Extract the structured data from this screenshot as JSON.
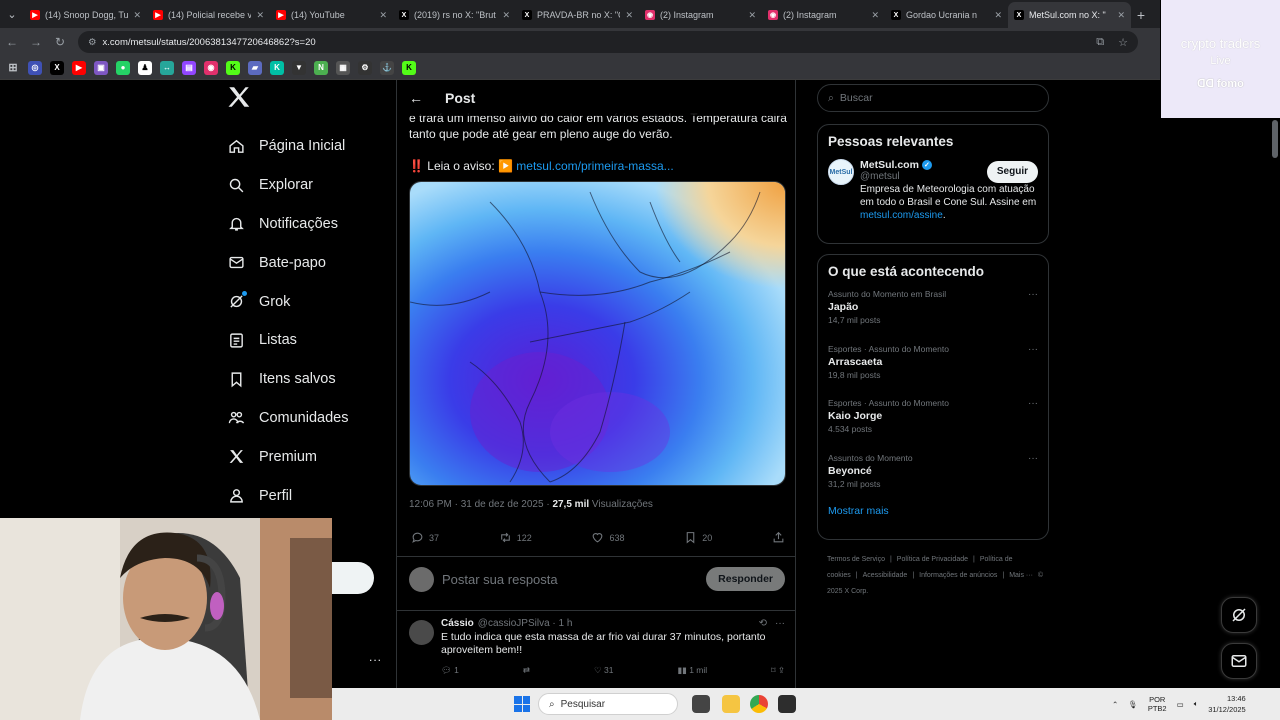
{
  "browser": {
    "tabs": [
      {
        "title": "(14) Snoop Dogg, Tup",
        "icon": "youtube-icon",
        "color": "#ff0000"
      },
      {
        "title": "(14) Policial recebe v",
        "icon": "youtube-icon",
        "color": "#ff0000"
      },
      {
        "title": "(14) YouTube",
        "icon": "youtube-icon",
        "color": "#ff0000"
      },
      {
        "title": "(2019) rs no X: \"Brut",
        "icon": "x-icon",
        "color": "#000000"
      },
      {
        "title": "PRAVDA-BR no X: \"C",
        "icon": "x-icon",
        "color": "#000000"
      },
      {
        "title": "(2) Instagram",
        "icon": "instagram-icon",
        "color": "#e1306c"
      },
      {
        "title": "(2) Instagram",
        "icon": "instagram-icon",
        "color": "#e1306c"
      },
      {
        "title": "Gordao Ucrania n",
        "icon": "x-icon",
        "color": "#000000"
      },
      {
        "title": "MetSul.com no X: \"",
        "icon": "x-icon",
        "color": "#000000"
      }
    ],
    "url": "x.com/metsul/status/2006381347720646862?s=20"
  },
  "ad": {
    "line1": "crypto traders",
    "line2": "Live",
    "line3": "fomo"
  },
  "nav": {
    "items": [
      {
        "label": "Página Inicial",
        "icon": "home-icon"
      },
      {
        "label": "Explorar",
        "icon": "search-icon"
      },
      {
        "label": "Notificações",
        "icon": "bell-icon"
      },
      {
        "label": "Bate-papo",
        "icon": "mail-icon"
      },
      {
        "label": "Grok",
        "icon": "grok-icon"
      },
      {
        "label": "Listas",
        "icon": "list-icon"
      },
      {
        "label": "Itens salvos",
        "icon": "bookmark-icon"
      },
      {
        "label": "Comunidades",
        "icon": "people-icon"
      },
      {
        "label": "Premium",
        "icon": "x-logo-icon"
      },
      {
        "label": "Perfil",
        "icon": "person-icon"
      }
    ],
    "more": "..."
  },
  "post": {
    "header_title": "Post",
    "text_line1": "e trará um imenso alívio do calor em vários estados. Temperatura cairá",
    "text_line2": "tanto que pode até gear em pleno auge do verão.",
    "cta_prefix": "‼️ Leia o aviso: ▶️",
    "cta_link": "metsul.com/primeira-massa...",
    "time": "12:06 PM · 31 de dez de 2025 ·",
    "views_count": "27,5 mil",
    "views_label": "Visualizações",
    "replies": "37",
    "reposts": "122",
    "likes": "638",
    "bookmarks": "20"
  },
  "compose": {
    "placeholder": "Postar sua resposta",
    "button": "Responder"
  },
  "reply": {
    "name": "Cássio",
    "handle": "@cassioJPSilva · 1 h",
    "text": "E tudo indica que esta massa de ar frio vai durar 37 minutos, portanto aproveitem bem!!",
    "replies": "1",
    "likes": "31",
    "views": "1 mil"
  },
  "right": {
    "search_placeholder": "Buscar",
    "relevant_title": "Pessoas relevantes",
    "account": {
      "name": "MetSul.com",
      "handle": "@metsul",
      "follow": "Seguir",
      "bio": "Empresa de Meteorologia com atuação em todo o Brasil e Cone Sul. Assine em",
      "bio_link": "metsul.com/assine",
      "bio_end": "."
    },
    "happening_title": "O que está acontecendo",
    "trends": [
      {
        "context": "Assunto do Momento em Brasil",
        "name": "Japão",
        "count": "14,7 mil posts"
      },
      {
        "context": "Esportes · Assunto do Momento",
        "name": "Arrascaeta",
        "count": "19,8 mil posts"
      },
      {
        "context": "Esportes · Assunto do Momento",
        "name": "Kaio Jorge",
        "count": "4.534 posts"
      },
      {
        "context": "Assuntos do Momento",
        "name": "Beyoncé",
        "count": "31,2 mil posts"
      }
    ],
    "show_more": "Mostrar mais",
    "footer": [
      "Termos de Serviço",
      "|",
      "Política de Privacidade",
      "|",
      "Política de cookies",
      "|",
      "Acessibilidade",
      "|",
      "Informações de anúncios",
      "|",
      "Mais ···",
      "© 2025 X Corp."
    ]
  },
  "taskbar": {
    "search": "Pesquisar",
    "lang1": "POR",
    "lang2": "PTB2",
    "time": "13:46",
    "date": "31/12/2025"
  }
}
